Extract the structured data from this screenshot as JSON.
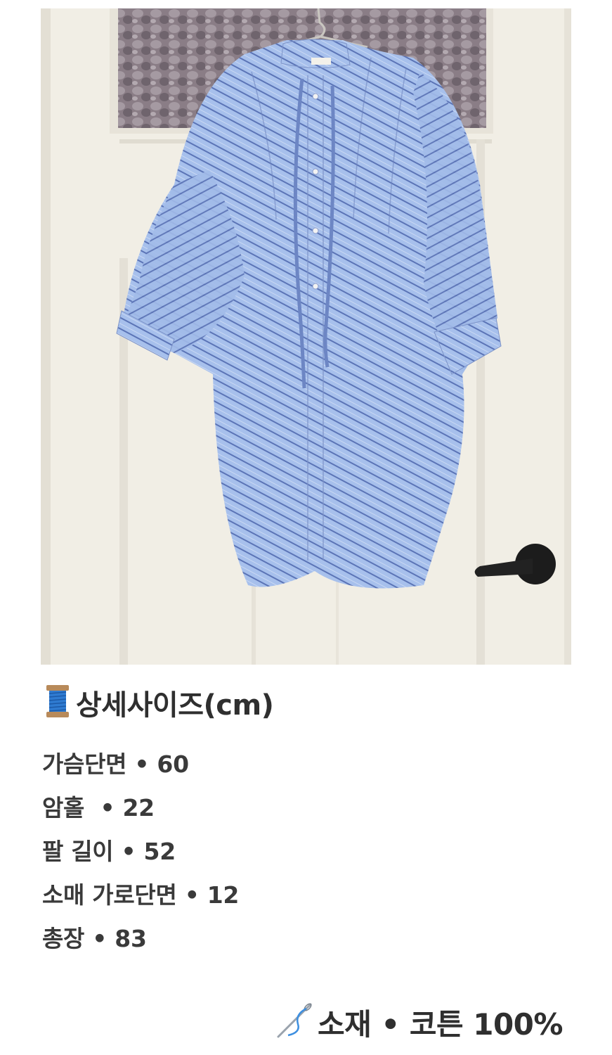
{
  "photo": {
    "subject": "striped shirt dress",
    "background": "white door"
  },
  "details": {
    "icon": "thread-spool-icon",
    "title": "상세사이즈(cm)",
    "specs": [
      "가슴단면 • 60",
      "암홀  • 22",
      "팔 길이 • 52",
      "소매 가로단면 • 12",
      "총장 • 83"
    ]
  },
  "material": {
    "icon": "needle-thread-icon",
    "label": "소재 • 코튼 100%"
  },
  "colors": {
    "fabric": "#9db7e6",
    "stripe": "#5a74b8",
    "door": "#f2efe6",
    "text": "#333333"
  }
}
